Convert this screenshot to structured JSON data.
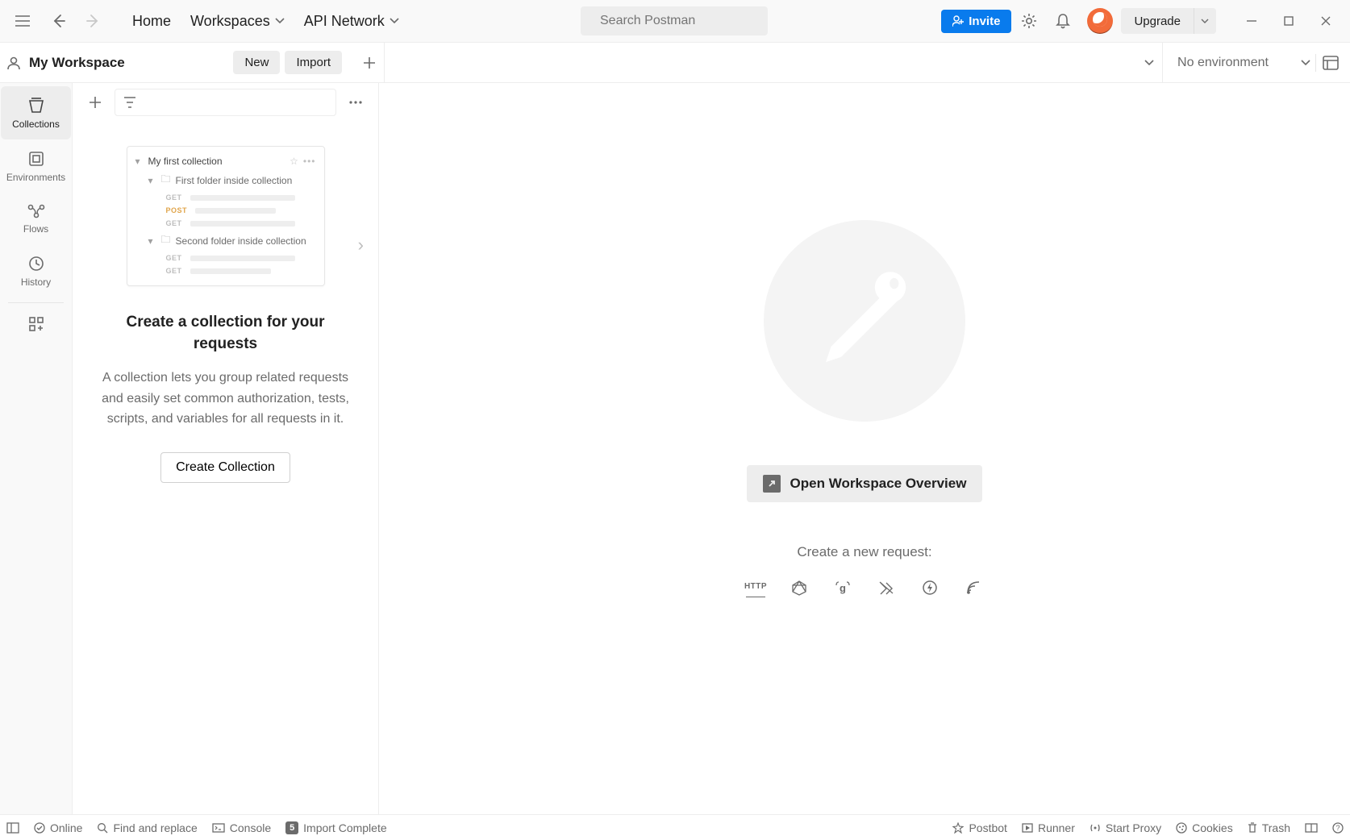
{
  "topbar": {
    "home": "Home",
    "workspaces": "Workspaces",
    "api_network": "API Network",
    "search_placeholder": "Search Postman",
    "invite": "Invite",
    "upgrade": "Upgrade"
  },
  "ws_header": {
    "title": "My Workspace",
    "new_btn": "New",
    "import_btn": "Import",
    "no_env": "No environment"
  },
  "rail": {
    "collections": "Collections",
    "environments": "Environments",
    "flows": "Flows",
    "history": "History"
  },
  "sidebar": {
    "illus": {
      "title": "My first collection",
      "folder1": "First folder inside collection",
      "folder2": "Second folder inside collection",
      "get": "GET",
      "post": "POST"
    },
    "empty_title_1": "Create a collection for your",
    "empty_title_2": "requests",
    "empty_desc": "A collection lets you group related requests and easily set common authorization, tests, scripts, and variables for all requests in it.",
    "create_btn": "Create Collection"
  },
  "content": {
    "overview_btn": "Open Workspace Overview",
    "new_request_label": "Create a new request:",
    "http_label": "HTTP"
  },
  "statusbar": {
    "online": "Online",
    "find_replace": "Find and replace",
    "console": "Console",
    "import_badge": "5",
    "import_complete": "Import Complete",
    "postbot": "Postbot",
    "runner": "Runner",
    "start_proxy": "Start Proxy",
    "cookies": "Cookies",
    "trash": "Trash"
  }
}
